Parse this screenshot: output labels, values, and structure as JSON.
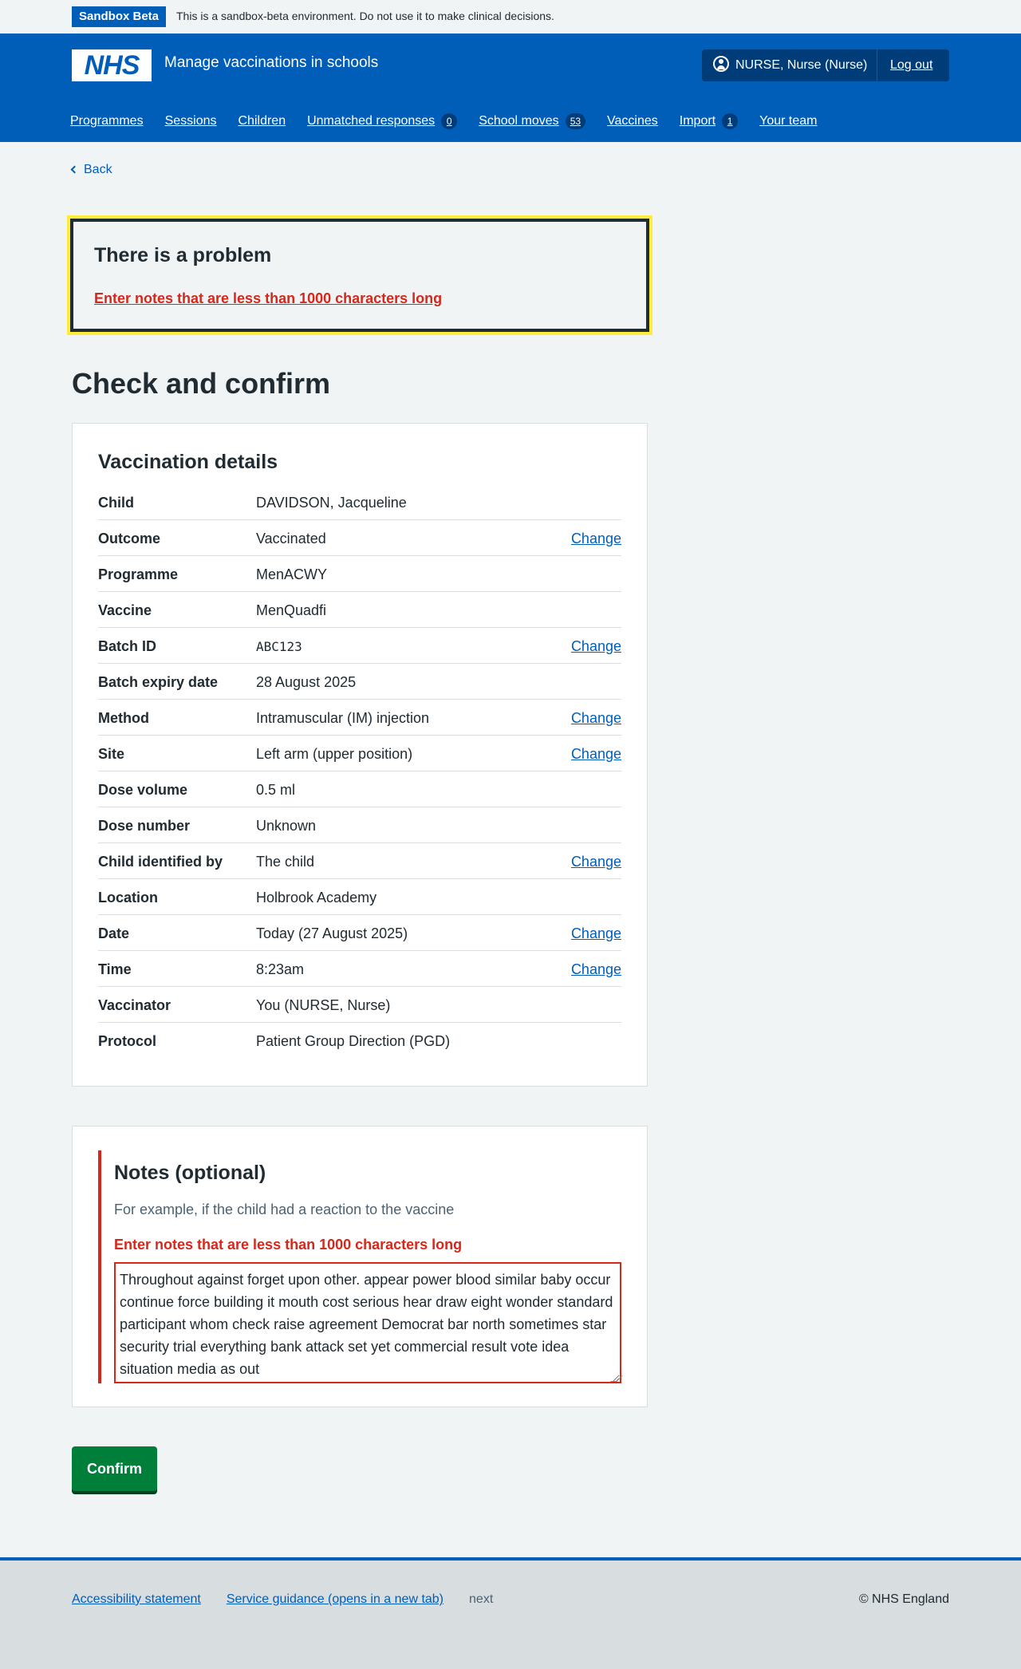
{
  "sandbox": {
    "tag": "Sandbox Beta",
    "message": "This is a sandbox-beta environment. Do not use it to make clinical decisions."
  },
  "header": {
    "logo": "NHS",
    "service_name": "Manage vaccinations in schools",
    "user": "NURSE, Nurse (Nurse)",
    "logout": "Log out",
    "user_icon": "user-circle-icon"
  },
  "nav": {
    "items": [
      {
        "label": "Programmes"
      },
      {
        "label": "Sessions"
      },
      {
        "label": "Children"
      },
      {
        "label": "Unmatched responses",
        "count": "0"
      },
      {
        "label": "School moves",
        "count": "53"
      },
      {
        "label": "Vaccines"
      },
      {
        "label": "Import",
        "count": "1"
      },
      {
        "label": "Your team"
      }
    ]
  },
  "back": {
    "label": "Back",
    "icon": "chevron-left-icon"
  },
  "error_summary": {
    "title": "There is a problem",
    "link": "Enter notes that are less than 1000 characters long"
  },
  "page_title": "Check and confirm",
  "vaccination": {
    "title": "Vaccination details",
    "change_label": "Change",
    "rows": [
      {
        "key": "Child",
        "value": "DAVIDSON, Jacqueline",
        "change": false
      },
      {
        "key": "Outcome",
        "value": "Vaccinated",
        "change": true
      },
      {
        "key": "Programme",
        "value": "MenACWY",
        "change": false
      },
      {
        "key": "Vaccine",
        "value": "MenQuadfi",
        "change": false
      },
      {
        "key": "Batch ID",
        "value": "ABC123",
        "change": true
      },
      {
        "key": "Batch expiry date",
        "value": "28 August 2025",
        "change": false
      },
      {
        "key": "Method",
        "value": "Intramuscular (IM) injection",
        "change": true
      },
      {
        "key": "Site",
        "value": "Left arm (upper position)",
        "change": true
      },
      {
        "key": "Dose volume",
        "value": "0.5 ml",
        "change": false
      },
      {
        "key": "Dose number",
        "value": "Unknown",
        "change": false
      },
      {
        "key": "Child identified by",
        "value": "The child",
        "change": true
      },
      {
        "key": "Location",
        "value": "Holbrook Academy",
        "change": false
      },
      {
        "key": "Date",
        "value": "Today (27 August 2025)",
        "change": true
      },
      {
        "key": "Time",
        "value": "8:23am",
        "change": true
      },
      {
        "key": "Vaccinator",
        "value": "You (NURSE, Nurse)",
        "change": false
      },
      {
        "key": "Protocol",
        "value": "Patient Group Direction (PGD)",
        "change": false
      }
    ]
  },
  "notes": {
    "label": "Notes (optional)",
    "hint": "For example, if the child had a reaction to the vaccine",
    "error": "Enter notes that are less than 1000 characters long",
    "value": "Throughout against forget upon other. appear power blood similar baby occur continue force building it mouth cost serious hear draw eight wonder standard participant whom check raise agreement Democrat bar north sometimes star security trial everything bank attack set yet commercial result vote idea situation media as out"
  },
  "confirm": {
    "label": "Confirm"
  },
  "footer": {
    "accessibility": "Accessibility statement",
    "guidance": "Service guidance (opens in a new tab)",
    "version": "next",
    "copyright": "© NHS England"
  }
}
